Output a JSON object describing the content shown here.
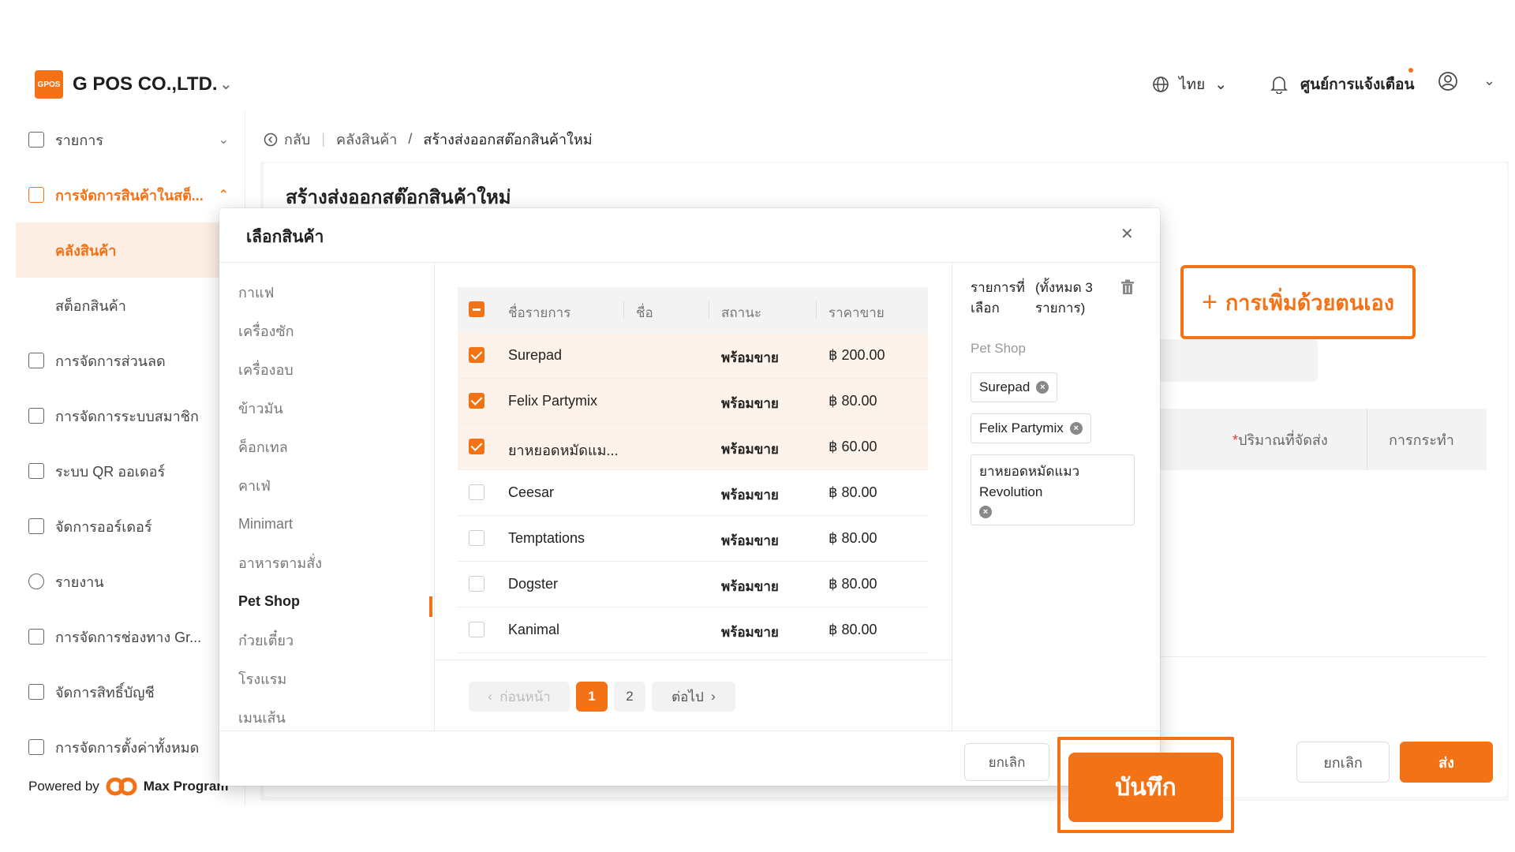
{
  "header": {
    "brand_logo_text": "GPOS",
    "brand_name": "G POS CO.,LTD.",
    "language": "ไทย",
    "notification_center": "ศูนย์การแจ้งเตือน"
  },
  "sidebar": {
    "items": [
      {
        "label": "รายการ",
        "icon": "list-icon"
      },
      {
        "label": "การจัดการสินค้าในสต็...",
        "icon": "store-icon"
      },
      {
        "label": "การจัดการส่วนลด",
        "icon": "discount-icon"
      },
      {
        "label": "การจัดการระบบสมาชิก",
        "icon": "member-icon"
      },
      {
        "label": "ระบบ QR ออเดอร์",
        "icon": "qr-icon"
      },
      {
        "label": "จัดการออร์เดอร์",
        "icon": "order-icon"
      },
      {
        "label": "รายงาน",
        "icon": "report-icon"
      },
      {
        "label": "การจัดการช่องทาง Gr...",
        "icon": "channel-icon"
      },
      {
        "label": "จัดการสิทธิ์บัญชี",
        "icon": "account-icon"
      },
      {
        "label": "การจัดการตั้งค่าทั้งหมด",
        "icon": "settings-icon"
      }
    ],
    "sub_items": [
      "คลังสินค้า",
      "สต็อกสินค้า"
    ],
    "powered_by": "Powered by",
    "powered_brand": "Max Program"
  },
  "breadcrumb": {
    "back": "กลับ",
    "parent": "คลังสินค้า",
    "separator": "/",
    "current": "สร้างส่งออกสต๊อกสินค้าใหม่"
  },
  "main": {
    "title": "สร้างส่งออกสต๊อกสินค้าใหม่",
    "manual_add": "การเพิ่มด้วยตนเอง",
    "col_qty_mark": "*",
    "col_qty": "ปริมาณที่จัดส่ง",
    "col_action": "การกระทำ",
    "cancel": "ยกเลิก",
    "send": "ส่ง"
  },
  "modal": {
    "title": "เลือกสินค้า",
    "categories": [
      "กาแฟ",
      "เครื่องซัก",
      "เครื่องอบ",
      "ข้าวมัน",
      "ค็อกเทล",
      "คาเฟ่",
      "Minimart",
      "อาหารตามสั่ง",
      "Pet Shop",
      "ก๋วยเตี๋ยว",
      "โรงแรม",
      "เมนเส้น"
    ],
    "active_category": "Pet Shop",
    "table_headers": {
      "item_name": "ชื่อรายการ",
      "name": "ชื่อ",
      "status": "สถานะ",
      "price": "ราคาขาย"
    },
    "products": [
      {
        "name": "Surepad",
        "status": "พร้อมขาย",
        "price": "฿ 200.00",
        "checked": true
      },
      {
        "name": "Felix Partymix",
        "status": "พร้อมขาย",
        "price": "฿ 80.00",
        "checked": true
      },
      {
        "name": "ยาหยอดหมัดแม...",
        "status": "พร้อมขาย",
        "price": "฿ 60.00",
        "checked": true
      },
      {
        "name": "Ceesar",
        "status": "พร้อมขาย",
        "price": "฿ 80.00",
        "checked": false
      },
      {
        "name": "Temptations",
        "status": "พร้อมขาย",
        "price": "฿ 80.00",
        "checked": false
      },
      {
        "name": "Dogster",
        "status": "พร้อมขาย",
        "price": "฿ 80.00",
        "checked": false
      },
      {
        "name": "Kanimal",
        "status": "พร้อมขาย",
        "price": "฿ 80.00",
        "checked": false
      }
    ],
    "pagination": {
      "prev": "ก่อนหน้า",
      "pages": [
        "1",
        "2"
      ],
      "current": "1",
      "next": "ต่อไป"
    },
    "selected_panel": {
      "label": "รายการที่เลือก",
      "count_label": "(ทั้งหมด 3 รายการ)",
      "group": "Pet Shop",
      "chips": [
        "Surepad",
        "Felix Partymix",
        "ยาหยอดหมัดแมว Revolution"
      ]
    },
    "cancel": "ยกเลิก",
    "save": "บันทึก"
  },
  "colors": {
    "accent": "#f47216",
    "selected_row": "#fdf3ea",
    "sidebar_selected": "#fdeee4"
  }
}
